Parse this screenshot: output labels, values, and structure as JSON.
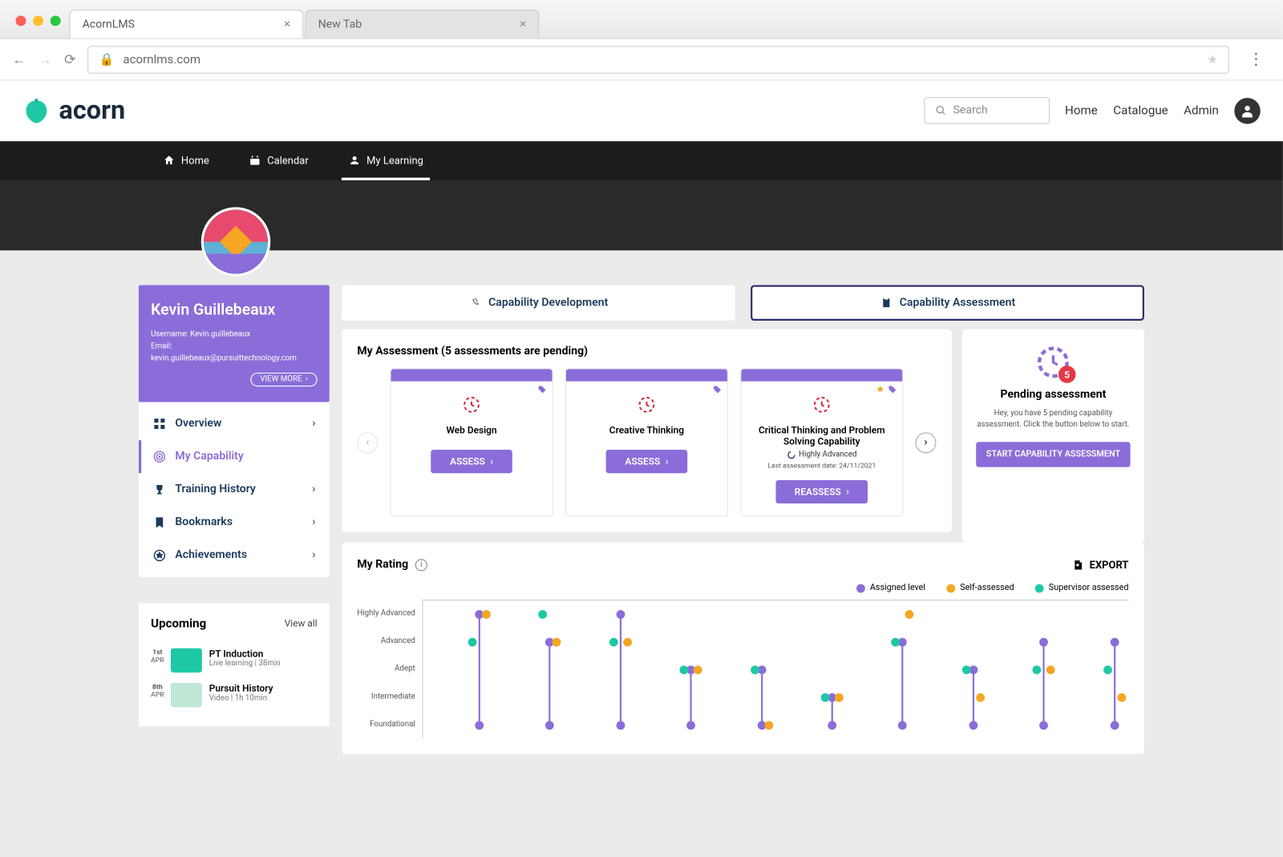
{
  "browser": {
    "tabs": [
      {
        "title": "AcornLMS",
        "active": true
      },
      {
        "title": "New Tab",
        "active": false
      }
    ],
    "url": "acornlms.com"
  },
  "header": {
    "brand": "acorn",
    "search_placeholder": "Search",
    "links": [
      "Home",
      "Catalogue",
      "Admin"
    ]
  },
  "nav": {
    "items": [
      {
        "label": "Home",
        "icon": "home"
      },
      {
        "label": "Calendar",
        "icon": "calendar"
      },
      {
        "label": "My Learning",
        "icon": "person",
        "active": true
      }
    ]
  },
  "user": {
    "name": "Kevin Guillebeaux",
    "username_label": "Username:",
    "username": "Kevin.guillebeaux",
    "email_label": "Email:",
    "email": "kevin.guillebeaux@pursuittechnology.com",
    "view_more": "VIEW MORE"
  },
  "sidebar": {
    "items": [
      {
        "label": "Overview",
        "icon": "grid",
        "chevron": true
      },
      {
        "label": "My Capability",
        "icon": "target",
        "active": true
      },
      {
        "label": "Training History",
        "icon": "trophy",
        "chevron": true
      },
      {
        "label": "Bookmarks",
        "icon": "bookmark",
        "chevron": true
      },
      {
        "label": "Achievements",
        "icon": "star-badge",
        "chevron": true
      }
    ]
  },
  "upcoming": {
    "title": "Upcoming",
    "view_all": "View all",
    "items": [
      {
        "date_top": "1st",
        "date_bottom": "APR",
        "title": "PT Induction",
        "sub": "Live learning   |   38min",
        "thumb_color": "#1ec8a5"
      },
      {
        "date_top": "8th",
        "date_bottom": "APR",
        "title": "Pursuit History",
        "sub": "Video   |   1h 10min",
        "thumb_color": "#bfe8d6"
      }
    ]
  },
  "main": {
    "tabs": [
      {
        "label": "Capability Development",
        "icon": "rocket"
      },
      {
        "label": "Capability Assessment",
        "icon": "clipboard",
        "active": true
      }
    ],
    "assessment": {
      "heading": "My Assessment (5 assessments are pending)",
      "cards": [
        {
          "title": "Web Design",
          "button": "ASSESS"
        },
        {
          "title": "Creative Thinking",
          "button": "ASSESS"
        },
        {
          "title": "Critical Thinking and Problem Solving Capability",
          "level": "Highly Advanced",
          "date_label": "Last assessment date:",
          "date": "24/11/2021",
          "button": "REASSESS",
          "starred": true
        }
      ]
    },
    "pending": {
      "count": "5",
      "title": "Pending assessment",
      "text": "Hey, you have 5 pending capability assessment. Click the button below to start.",
      "button": "START CAPABILITY ASSESSMENT"
    },
    "rating": {
      "title": "My Rating",
      "export": "EXPORT",
      "legend": [
        {
          "label": "Assigned level",
          "color": "purple"
        },
        {
          "label": "Self-assessed",
          "color": "orange"
        },
        {
          "label": "Supervisor assessed",
          "color": "teal"
        }
      ],
      "y_levels": [
        "Highly Advanced",
        "Advanced",
        "Adept",
        "Intermediate",
        "Foundational"
      ]
    }
  },
  "chart_data": {
    "type": "dot-range",
    "y_categories": [
      "Foundational",
      "Intermediate",
      "Adept",
      "Advanced",
      "Highly Advanced"
    ],
    "y_index": {
      "Foundational": 0,
      "Intermediate": 1,
      "Adept": 2,
      "Advanced": 3,
      "Highly Advanced": 4
    },
    "series": [
      {
        "name": "Assigned level",
        "color": "#8a6dd9",
        "type": "range",
        "values": [
          {
            "x": 0,
            "low": 0,
            "high": 4
          },
          {
            "x": 1,
            "low": 0,
            "high": 3
          },
          {
            "x": 2,
            "low": 0,
            "high": 4
          },
          {
            "x": 3,
            "low": 0,
            "high": 2
          },
          {
            "x": 4,
            "low": 0,
            "high": 2
          },
          {
            "x": 5,
            "low": 0,
            "high": 1
          },
          {
            "x": 6,
            "low": 0,
            "high": 3
          },
          {
            "x": 7,
            "low": 0,
            "high": 2
          },
          {
            "x": 8,
            "low": 0,
            "high": 3
          },
          {
            "x": 9,
            "low": 0,
            "high": 3
          }
        ]
      },
      {
        "name": "Self-assessed",
        "color": "#f5a623",
        "type": "point",
        "values": [
          4,
          3,
          3,
          2,
          0,
          1,
          4,
          1,
          2,
          1
        ]
      },
      {
        "name": "Supervisor assessed",
        "color": "#1ec8a5",
        "type": "point",
        "values": [
          3,
          4,
          3,
          2,
          2,
          1,
          3,
          2,
          2,
          2
        ]
      }
    ],
    "x_count": 10
  }
}
